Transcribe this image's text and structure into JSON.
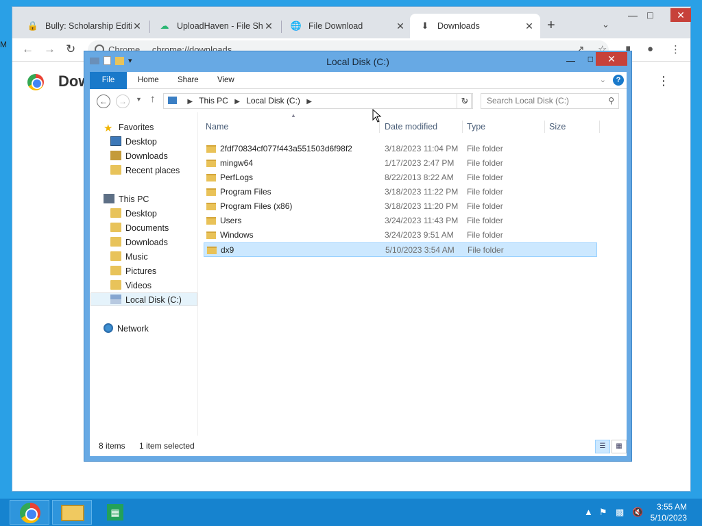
{
  "browser": {
    "tabs": [
      {
        "title": "Bully: Scholarship Editio",
        "favicon": "lock-icon"
      },
      {
        "title": "UploadHaven - File Sha",
        "favicon": "cloud-icon"
      },
      {
        "title": "File Download",
        "favicon": "globe-icon"
      },
      {
        "title": "Downloads",
        "favicon": "download-icon"
      }
    ],
    "omnibox": {
      "chip": "Chrome",
      "url": "chrome://downloads"
    },
    "page_title": "Dow",
    "stray_text": "M"
  },
  "explorer": {
    "title": "Local Disk (C:)",
    "ribbon_tabs": [
      "File",
      "Home",
      "Share",
      "View"
    ],
    "help": "?",
    "breadcrumb": [
      "This PC",
      "Local Disk (C:)"
    ],
    "search_placeholder": "Search Local Disk (C:)",
    "nav": {
      "favorites": "Favorites",
      "favorites_items": [
        "Desktop",
        "Downloads",
        "Recent places"
      ],
      "this_pc": "This PC",
      "this_pc_items": [
        "Desktop",
        "Documents",
        "Downloads",
        "Music",
        "Pictures",
        "Videos",
        "Local Disk (C:)"
      ],
      "network": "Network"
    },
    "columns": [
      "Name",
      "Date modified",
      "Type",
      "Size"
    ],
    "files": [
      {
        "name": "2fdf70834cf077f443a551503d6f98f2",
        "date": "3/18/2023 11:04 PM",
        "type": "File folder"
      },
      {
        "name": "mingw64",
        "date": "1/17/2023 2:47 PM",
        "type": "File folder"
      },
      {
        "name": "PerfLogs",
        "date": "8/22/2013 8:22 AM",
        "type": "File folder"
      },
      {
        "name": "Program Files",
        "date": "3/18/2023 11:22 PM",
        "type": "File folder"
      },
      {
        "name": "Program Files (x86)",
        "date": "3/18/2023 11:20 PM",
        "type": "File folder"
      },
      {
        "name": "Users",
        "date": "3/24/2023 11:43 PM",
        "type": "File folder"
      },
      {
        "name": "Windows",
        "date": "3/24/2023 9:51 AM",
        "type": "File folder"
      },
      {
        "name": "dx9",
        "date": "5/10/2023 3:54 AM",
        "type": "File folder"
      }
    ],
    "status": {
      "items": "8 items",
      "selected": "1 item selected"
    }
  },
  "taskbar": {
    "time": "3:55 AM",
    "date": "5/10/2023"
  },
  "colors": {
    "accent": "#1979ca",
    "selection": "#cce8ff",
    "taskbar": "#1683cf",
    "close": "#c7413a"
  }
}
